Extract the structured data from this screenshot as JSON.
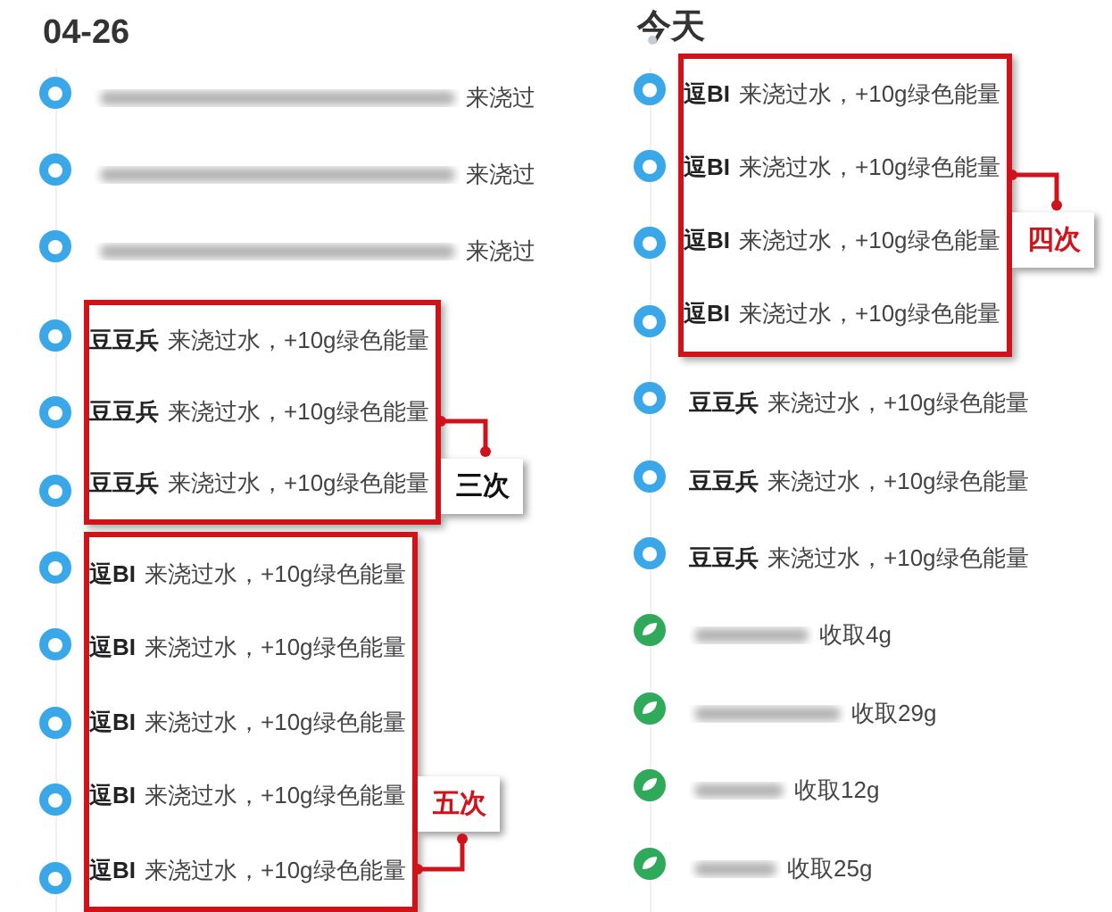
{
  "columns": [
    {
      "date": "04-26",
      "today_dot": false,
      "groups": [
        {
          "entries": [
            {
              "kind": "watered",
              "redacted": true,
              "text": "来浇过"
            },
            {
              "kind": "watered",
              "redacted": true,
              "text": "来浇过"
            },
            {
              "kind": "watered",
              "redacted": true,
              "text": "来浇过"
            }
          ]
        },
        {
          "callout": {
            "label": "三次",
            "color": "#111111",
            "kind": "label_below"
          },
          "entries": [
            {
              "kind": "watered",
              "name": "豆豆兵",
              "text": "来浇过水，+10g绿色能量"
            },
            {
              "kind": "watered",
              "name": "豆豆兵",
              "text": "来浇过水，+10g绿色能量"
            },
            {
              "kind": "watered",
              "name": "豆豆兵",
              "text": "来浇过水，+10g绿色能量"
            }
          ]
        },
        {
          "callout": {
            "label": "五次",
            "color": "#d0121b",
            "kind": "label_above"
          },
          "entries": [
            {
              "kind": "watered",
              "name": "逗BI",
              "text": "来浇过水，+10g绿色能量"
            },
            {
              "kind": "watered",
              "name": "逗BI",
              "text": "来浇过水，+10g绿色能量"
            },
            {
              "kind": "watered",
              "name": "逗BI",
              "text": "来浇过水，+10g绿色能量"
            },
            {
              "kind": "watered",
              "name": "逗BI",
              "text": "来浇过水，+10g绿色能量"
            },
            {
              "kind": "watered",
              "name": "逗BI",
              "text": "来浇过水，+10g绿色能量"
            }
          ]
        }
      ]
    },
    {
      "date": "今天",
      "today_dot": true,
      "groups": [
        {
          "callout": {
            "label": "四次",
            "color": "#d0121b",
            "kind": "label_below"
          },
          "entries": [
            {
              "kind": "watered",
              "name": "逗BI",
              "text": "来浇过水，+10g绿色能量"
            },
            {
              "kind": "watered",
              "name": "逗BI",
              "text": "来浇过水，+10g绿色能量"
            },
            {
              "kind": "watered",
              "name": "逗BI",
              "text": "来浇过水，+10g绿色能量"
            },
            {
              "kind": "watered",
              "name": "逗BI",
              "text": "来浇过水，+10g绿色能量"
            }
          ]
        },
        {
          "entries": [
            {
              "kind": "watered",
              "name": "豆豆兵",
              "text": "来浇过水，+10g绿色能量"
            },
            {
              "kind": "watered",
              "name": "豆豆兵",
              "text": "来浇过水，+10g绿色能量"
            },
            {
              "kind": "watered",
              "name": "豆豆兵",
              "text": "来浇过水，+10g绿色能量"
            },
            {
              "kind": "collected",
              "redacted": true,
              "text": "收取4g"
            },
            {
              "kind": "collected",
              "redacted": true,
              "text": "收取29g"
            },
            {
              "kind": "collected",
              "redacted": true,
              "text": "收取12g"
            },
            {
              "kind": "collected",
              "redacted": true,
              "text": "收取25g"
            }
          ]
        }
      ]
    }
  ]
}
